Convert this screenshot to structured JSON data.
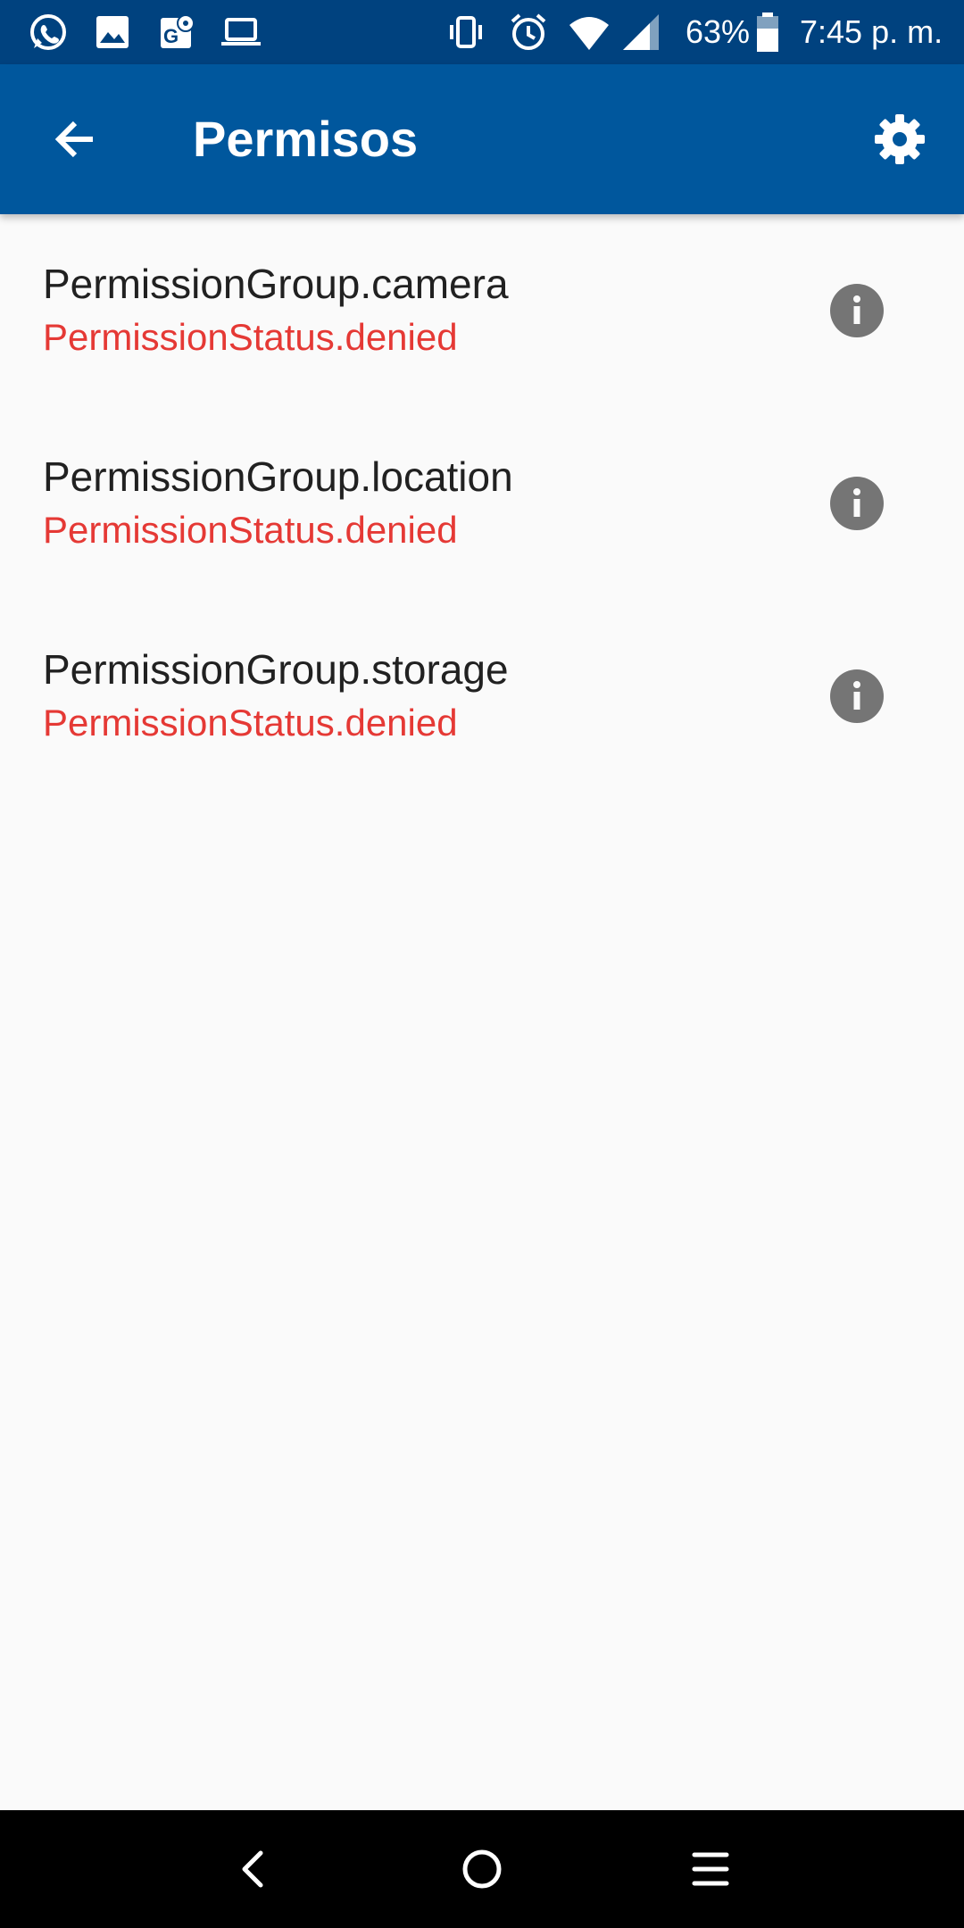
{
  "status_bar": {
    "battery": "63%",
    "time": "7:45 p. m.",
    "left_icons": [
      "whatsapp-icon",
      "gallery-icon",
      "maps-icon",
      "laptop-icon"
    ],
    "right_icons": [
      "vibrate-icon",
      "alarm-icon",
      "wifi-icon",
      "signal-icon",
      "battery-icon"
    ]
  },
  "app_bar": {
    "title": "Permisos",
    "back_icon": "arrow-back-icon",
    "settings_icon": "gear-icon"
  },
  "permissions": [
    {
      "group": "PermissionGroup.camera",
      "status": "PermissionStatus.denied"
    },
    {
      "group": "PermissionGroup.location",
      "status": "PermissionStatus.denied"
    },
    {
      "group": "PermissionGroup.storage",
      "status": "PermissionStatus.denied"
    }
  ],
  "colors": {
    "status_bar": "#00427f",
    "app_bar": "#00579d",
    "background": "#fafafa",
    "status_denied": "#e53935",
    "info_icon": "#757575"
  },
  "nav_bar": {
    "icons": [
      "nav-back-icon",
      "nav-home-icon",
      "nav-recents-icon"
    ]
  }
}
